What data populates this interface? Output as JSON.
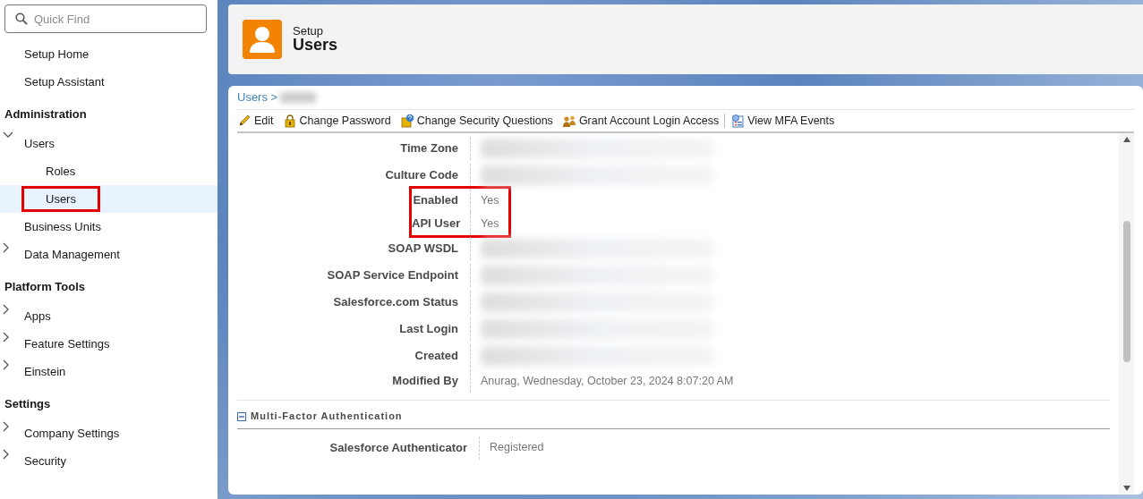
{
  "sidebar": {
    "search": {
      "placeholder": "Quick Find"
    },
    "items": [
      {
        "kind": "link",
        "label": "Setup Home"
      },
      {
        "kind": "link",
        "label": "Setup Assistant"
      },
      {
        "kind": "heading",
        "label": "Administration"
      },
      {
        "kind": "group",
        "label": "Users",
        "expanded": true,
        "children": [
          {
            "label": "Roles",
            "selected": false,
            "highlighted": false
          },
          {
            "label": "Users",
            "selected": true,
            "highlighted": true
          }
        ]
      },
      {
        "kind": "link",
        "label": "Business Units"
      },
      {
        "kind": "group",
        "label": "Data Management",
        "expanded": false
      },
      {
        "kind": "heading",
        "label": "Platform Tools"
      },
      {
        "kind": "group",
        "label": "Apps",
        "expanded": false
      },
      {
        "kind": "group",
        "label": "Feature Settings",
        "expanded": false
      },
      {
        "kind": "group",
        "label": "Einstein",
        "expanded": false
      },
      {
        "kind": "heading",
        "label": "Settings"
      },
      {
        "kind": "group",
        "label": "Company Settings",
        "expanded": false
      },
      {
        "kind": "group",
        "label": "Security",
        "expanded": false
      }
    ]
  },
  "header": {
    "eyebrow": "Setup",
    "title": "Users"
  },
  "breadcrumb": {
    "link": "Users >"
  },
  "toolbar": [
    {
      "label": "Edit"
    },
    {
      "label": "Change Password"
    },
    {
      "label": "Change Security Questions"
    },
    {
      "label": "Grant Account Login Access"
    },
    {
      "label": "View MFA Events"
    }
  ],
  "fields": [
    {
      "label": "Time Zone",
      "kind": "redacted",
      "highlighted": false
    },
    {
      "label": "Culture Code",
      "kind": "redacted",
      "highlighted": false
    },
    {
      "label": "Enabled",
      "kind": "text",
      "value": "Yes",
      "highlighted": true
    },
    {
      "label": "API User",
      "kind": "text",
      "value": "Yes",
      "highlighted": true
    },
    {
      "label": "SOAP WSDL",
      "kind": "redacted",
      "highlighted": false
    },
    {
      "label": "SOAP Service Endpoint",
      "kind": "redacted",
      "highlighted": false
    },
    {
      "label": "Salesforce.com Status",
      "kind": "redacted",
      "highlighted": false
    },
    {
      "label": "Last Login",
      "kind": "redacted",
      "highlighted": false
    },
    {
      "label": "Created",
      "kind": "redacted",
      "highlighted": false
    },
    {
      "label": "Modified By",
      "kind": "text",
      "value": "Anurag, Wednesday, October 23, 2024 8:07:20 AM",
      "highlighted": false
    }
  ],
  "section": {
    "title": "Multi-Factor Authentication",
    "expanded": true,
    "fields": [
      {
        "label": "Salesforce Authenticator",
        "kind": "text",
        "value": "Registered"
      }
    ]
  }
}
